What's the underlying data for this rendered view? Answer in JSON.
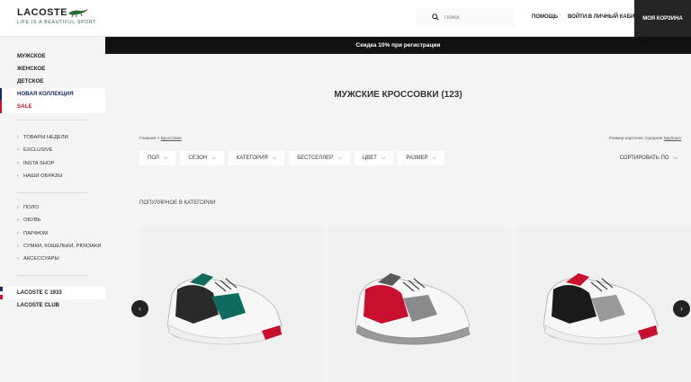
{
  "header": {
    "logo_text": "LACOSTE",
    "logo_tagline": "LIFE IS A BEAUTIFUL SPORT",
    "search_placeholder": "Поиск",
    "help": "Помощь",
    "login": "Войти в личный кабинет",
    "cart": "Моя корзина"
  },
  "promo": "Скидка 10% при регистрации",
  "sidebar": {
    "main": [
      {
        "label": "Мужское"
      },
      {
        "label": "Женское"
      },
      {
        "label": "Детское"
      },
      {
        "label": "Новая коллекция"
      },
      {
        "label": "Sale"
      }
    ],
    "group1": [
      {
        "label": "Товары недели"
      },
      {
        "label": "Exclusive"
      },
      {
        "label": "Insta shop"
      },
      {
        "label": "Наши образы"
      }
    ],
    "group2": [
      {
        "label": "Поло"
      },
      {
        "label": "Обувь"
      },
      {
        "label": "Парфюм"
      },
      {
        "label": "Сумки, кошельки, рюкзаки"
      },
      {
        "label": "Аксессуары"
      }
    ],
    "bottom": [
      {
        "label": "Lacoste с 1933"
      },
      {
        "label": "Lacoste Club"
      }
    ]
  },
  "main": {
    "title": "Мужские кроссовки (123)",
    "breadcrumb": {
      "home": "Главная",
      "sep": ">",
      "current": "Кроссовки"
    },
    "card_size": {
      "label": "Размер карточек:",
      "options": [
        "Средние",
        "Крупные"
      ]
    },
    "filters": [
      {
        "label": "Пол"
      },
      {
        "label": "Сезон"
      },
      {
        "label": "Категория"
      },
      {
        "label": "Бестселлер"
      },
      {
        "label": "Цвет"
      },
      {
        "label": "Размер"
      }
    ],
    "sort": "Сортировать по",
    "popular": "Популярное в категории"
  },
  "products": [
    {
      "icon": "sneaker-white-green-black",
      "accent": "#0e6b5e",
      "secondary": "#2a2a2a"
    },
    {
      "icon": "sneaker-white-red-grey",
      "accent": "#c8102e",
      "secondary": "#8a8a8a"
    },
    {
      "icon": "sneaker-white-black-red",
      "accent": "#1a1a1a",
      "secondary": "#9a9a9a"
    }
  ],
  "colors": {
    "brand_green": "#2a6a3a",
    "sale_red": "#d3102b",
    "active_navy": "#1a2b6b",
    "dark": "#252525"
  }
}
